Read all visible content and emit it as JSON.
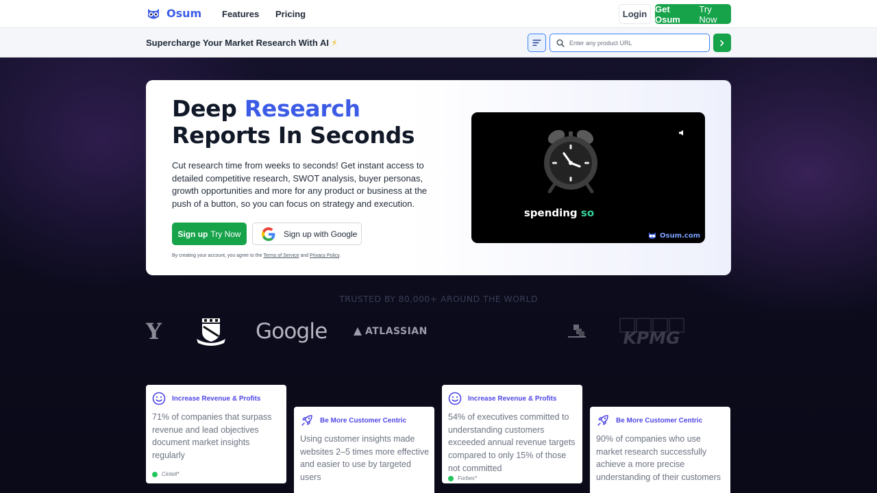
{
  "brand": {
    "name": "Osum",
    "accent_color": "#3d5ce6",
    "cta_color": "#16a34a"
  },
  "nav": {
    "features": "Features",
    "pricing": "Pricing",
    "login": "Login",
    "cta_bold": "Get Osum",
    "cta_light": "Try Now"
  },
  "subbar": {
    "tagline": "Supercharge Your Market Research With AI",
    "tagline_icon": "⚡",
    "search_placeholder": "Enter any product URL",
    "search_value": ""
  },
  "hero": {
    "title_word1": "Deep",
    "title_accent": "Research",
    "title_line2": "Reports In Seconds",
    "description": "Cut research time from weeks to seconds! Get instant access to detailed competitive research, SWOT analysis, buyer personas, growth opportunities and more for any product or business at the push of a button, so you can focus on strategy and execution.",
    "signup_bold": "Sign up",
    "signup_light": "Try Now",
    "google_label": "Sign up with Google",
    "terms_prefix": "By creating your account, you agree to the",
    "terms_link": "Terms of Service",
    "terms_and": "and",
    "privacy_link": "Privacy Policy",
    "terms_suffix": "."
  },
  "video": {
    "caption_word": "spending",
    "caption_accent": "so",
    "brand": "Osum.com"
  },
  "trusted": {
    "heading": "TRUSTED BY 80,000+ AROUND THE WORLD",
    "logos": {
      "y": "Y",
      "google": "Google",
      "atlassian": "ATLASSIAN",
      "kpmg": "KPMG"
    }
  },
  "stats": [
    {
      "heading": "Increase Revenue & Profits",
      "icon": "smile-icon",
      "body": "71% of companies that surpass revenue and lead objectives document market insights regularly",
      "source": "Cintell*"
    },
    {
      "heading": "Be More Customer Centric",
      "icon": "rocket-icon",
      "body": "Using customer insights made websites 2–5 times more effective and easier to use by targeted users",
      "source": ""
    },
    {
      "heading": "Increase Revenue & Profits",
      "icon": "smile-icon",
      "body": "54% of executives committed to understanding customers exceeded annual revenue targets compared to only 15% of those not committed",
      "source": "Forbes*"
    },
    {
      "heading": "Be More Customer Centric",
      "icon": "rocket-icon",
      "body": "90% of companies who use market research successfully achieve a more precise understanding of their customers",
      "source": ""
    }
  ]
}
